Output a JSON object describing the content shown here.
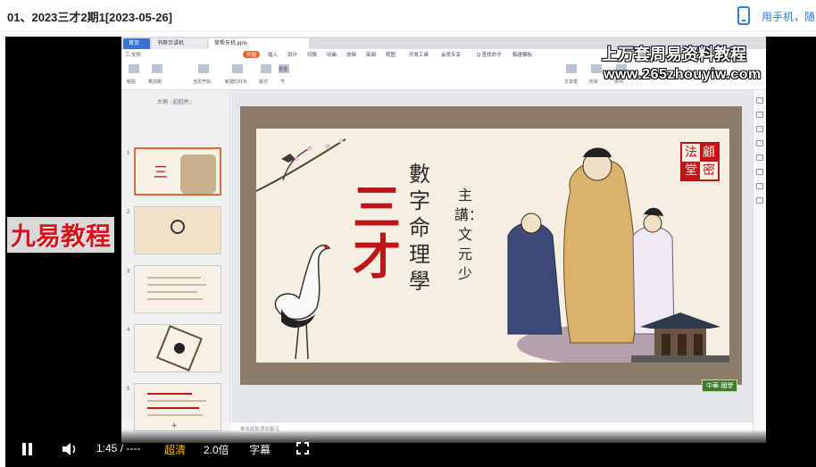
{
  "header": {
    "title": "01、2023三才2期1[2023-05-26]",
    "phone_link": "用手机，随"
  },
  "watermarks": {
    "line1": "上万套周易资料教程",
    "line2": "www.265zhouyiw.com",
    "brand": "九易教程",
    "bottom_badge": "中華·國學"
  },
  "wps": {
    "tabs": [
      "首页",
      "书荐示讲机",
      "草帮东机.pptx"
    ],
    "menu": [
      "三 文件",
      "开始",
      "插入",
      "设计",
      "切换",
      "动画",
      "放映",
      "审阅",
      "视图",
      "开发工具",
      "会员专享",
      "Q 查找命令",
      "稿速模板"
    ],
    "ribbon": [
      "粘贴",
      "格式刷",
      "当页开始",
      "新建幻灯片",
      "版式",
      "节",
      "重置",
      "文本框",
      "形状",
      "排列"
    ],
    "thumb_tabs": [
      "大纲",
      "幻灯片"
    ],
    "add_slide": "+",
    "notes_placeholder": "单击此处添加备注"
  },
  "slide": {
    "big_title": "三才",
    "subtitle": "數字命理學",
    "lecturer": "主講：文元少",
    "seal": [
      "法",
      "顧",
      "堂",
      "密"
    ]
  },
  "player": {
    "time": "1:45 / ----",
    "quality": "超清",
    "speed": "2.0倍",
    "subtitle": "字幕"
  },
  "colors": {
    "accent_blue": "#2a7de1",
    "title_red": "#c0141b",
    "quality_gold": "#ffb400"
  }
}
